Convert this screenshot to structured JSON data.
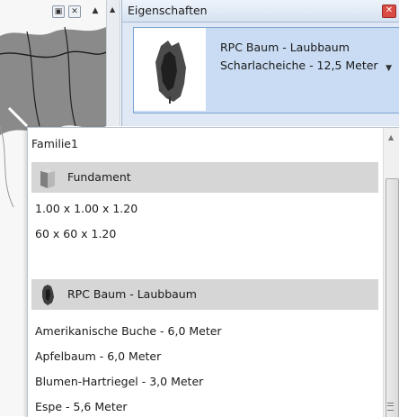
{
  "properties_palette": {
    "title": "Eigenschaften",
    "close_icon": "close-icon",
    "type_selector": {
      "current_type": "RPC Baum - Laubbaum Scharlacheiche - 12,5 Meter",
      "thumbnail_icon": "tree-thumbnail-icon"
    }
  },
  "canvas": {
    "window_buttons": [
      "restore-icon",
      "close-icon"
    ]
  },
  "dropdown": {
    "family_header": "Familie1",
    "groups": [
      {
        "label": "Fundament",
        "icon": "foundation-icon",
        "items": [
          "1.00 x 1.00 x 1.20",
          "60 x 60 x 1.20"
        ]
      },
      {
        "label": "RPC Baum - Laubbaum",
        "icon": "tree-icon",
        "items": [
          "Amerikanische Buche - 6,0 Meter",
          "Apfelbaum - 6,0 Meter",
          "Blumen-Hartriegel - 3,0 Meter",
          "Espe - 5,6 Meter"
        ]
      }
    ]
  },
  "colors": {
    "header_bg": "#dfe8f4",
    "selector_bg": "#c9dcf3",
    "group_row_bg": "#d6d6d6",
    "close_red": "#d94c43"
  }
}
